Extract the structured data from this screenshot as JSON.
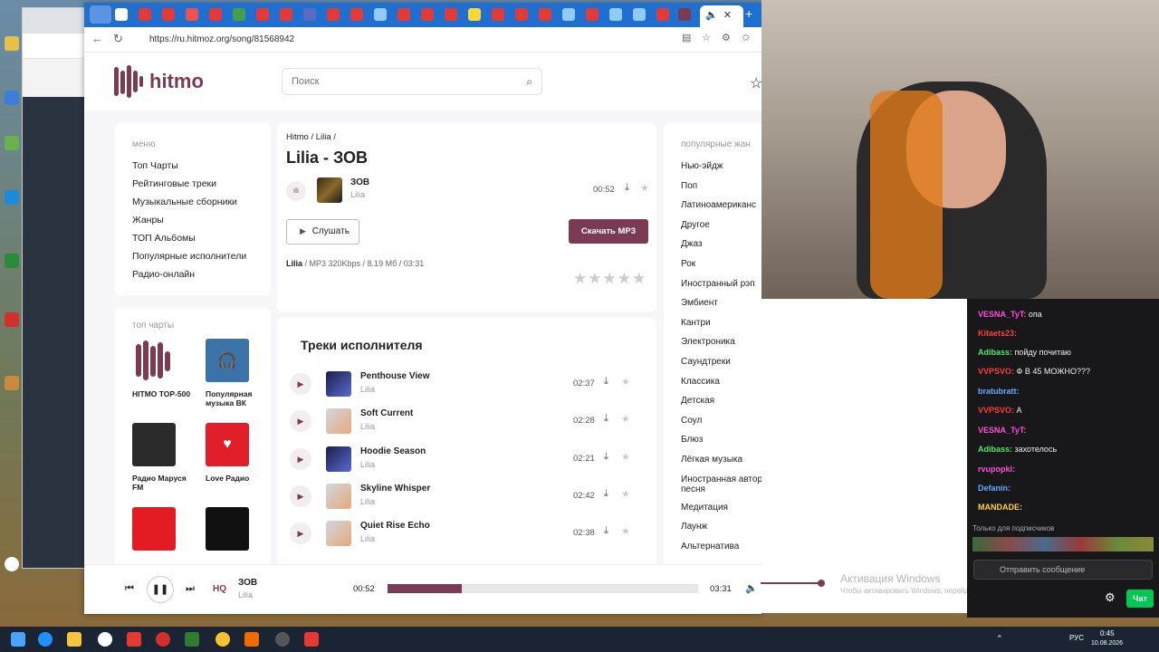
{
  "browser": {
    "url": "https://ru.hitmoz.org/song/81568942"
  },
  "site": {
    "logo_text": "hitmo",
    "search_placeholder": "Поиск",
    "menu_title": "меню",
    "menu": [
      "Топ Чарты",
      "Рейтинговые треки",
      "Музыкальные сборники",
      "Жанры",
      "ТОП Альбомы",
      "Популярные исполнители",
      "Радио-онлайн"
    ],
    "charts_title": "топ чарты",
    "charts": [
      "HITMO TOP-500",
      "Популярная музыка ВК",
      "Радио Маруся FM",
      "Love Радио"
    ],
    "breadcrumb": [
      "Hitmo /",
      "Lilia /"
    ],
    "page_title": "Lilia - ЗОВ",
    "track": {
      "name": "ЗОВ",
      "artist": "Lilia",
      "duration": "00:52"
    },
    "listen_label": "Слушать",
    "download_label": "Скачать MP3",
    "meta_artist": "Lilia",
    "meta_info": " / MP3 320Kbps / 8.19 Mб / 03:31",
    "artist_tracks_title": "Треки исполнителя",
    "artist_tracks": [
      {
        "name": "Penthouse View",
        "artist": "Lilia",
        "duration": "02:37"
      },
      {
        "name": "Soft Current",
        "artist": "Lilia",
        "duration": "02:28"
      },
      {
        "name": "Hoodie Season",
        "artist": "Lilia",
        "duration": "02:21"
      },
      {
        "name": "Skyline Whisper",
        "artist": "Lilia",
        "duration": "02:42"
      },
      {
        "name": "Quiet Rise Echo",
        "artist": "Lilia",
        "duration": "02:38"
      }
    ],
    "genres_title": "популярные жан",
    "genres": [
      "Нью-эйдж",
      "Поп",
      "Латиноамериканс",
      "Другое",
      "Джаз",
      "Рок",
      "Иностранный рэп",
      "Эмбиент",
      "Кантри",
      "Электроника",
      "Саундтреки",
      "Классика",
      "Детская",
      "Соул",
      "Блюз",
      "Лёгкая музыка",
      "Иностранная авторская",
      "песня",
      "Медитация",
      "Лаунж",
      "Альтернатива"
    ],
    "player": {
      "hq": "HQ",
      "title": "ЗОВ",
      "artist": "Lilia",
      "elapsed": "00:52",
      "total": "03:31",
      "progress": 0.24,
      "volume": 1.0
    }
  },
  "chat": {
    "messages": [
      {
        "user": "VESNA_TyT:",
        "text": " опа",
        "color": "#ff4fd8"
      },
      {
        "user": "Kitaets23:",
        "text": "",
        "color": "#ff3b3b"
      },
      {
        "user": "Adibass:",
        "text": " пойду почитаю",
        "color": "#4fe36b"
      },
      {
        "user": "VVPSVO:",
        "text": " Ф В 45 МОЖНО???",
        "color": "#ff3b3b"
      },
      {
        "user": "bratubratt:",
        "text": "",
        "color": "#6aa8ff"
      },
      {
        "user": "VVPSVO:",
        "text": " А",
        "color": "#ff3b3b"
      },
      {
        "user": "VESNA_TyT:",
        "text": "",
        "color": "#ff4fd8"
      },
      {
        "user": "Adibass:",
        "text": " захотелось",
        "color": "#4fe36b"
      },
      {
        "user": "rvupopki:",
        "text": "",
        "color": "#ff4fd8"
      },
      {
        "user": "Defanin:",
        "text": "",
        "color": "#6aa8ff"
      },
      {
        "user": "MANDADE:",
        "text": "",
        "color": "#ffd23b"
      }
    ],
    "subs_note": "Только для подписчиков",
    "input_placeholder": "Отправить сообщение",
    "chat_button": "Чат"
  },
  "watermark": {
    "line1": "Активация Windows",
    "line2": "Чтобы активировать Windows, перейдите в раздел \"Параметры\"."
  },
  "taskbar": {
    "lang": "РУС",
    "time": "0:45",
    "date": "10.08.2026"
  }
}
